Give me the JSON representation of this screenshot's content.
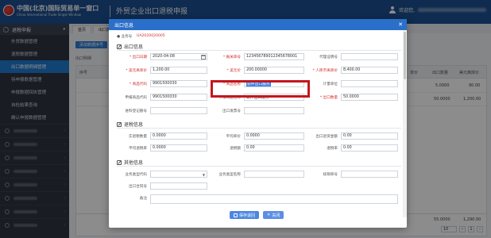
{
  "header": {
    "brand_cn": "中国(北京)国际贸易单一窗口",
    "brand_en": "China International Trade Single Window",
    "system_title": "外贸企业出口退税申报",
    "welcome": "欢迎您,"
  },
  "sidebar": {
    "head": "退税申报",
    "items": [
      {
        "label": "外贸数据管理",
        "active": false
      },
      {
        "label": "退税数据管理",
        "active": false
      },
      {
        "label": "出口数据明细管理",
        "active": true
      },
      {
        "label": "待申报数据管理",
        "active": false
      },
      {
        "label": "申报数据回执管理",
        "active": false
      },
      {
        "label": "自检结果查询",
        "active": false
      },
      {
        "label": "确认申报数据管理",
        "active": false
      }
    ],
    "collapsed_groups": [
      {
        "label": "预申报"
      },
      {
        "label": "代办退税"
      },
      {
        "label": "数据导入"
      },
      {
        "label": "备案"
      },
      {
        "label": "查询"
      },
      {
        "label": "单证"
      },
      {
        "label": "系统维护"
      },
      {
        "label": "其他"
      }
    ]
  },
  "background": {
    "tabs": [
      "首页",
      "出口数据明细管理"
    ],
    "add_button": "添加数据序号",
    "subtab": "出口明细",
    "columns": [
      "序号",
      "",
      "",
      "",
      "",
      "",
      "",
      "",
      "",
      "",
      "",
      "单价",
      "出口数量",
      "美元离岸价"
    ],
    "rows": [
      {
        "unit_price": "",
        "qty": "5.0000",
        "fob": "90.00"
      },
      {
        "unit_price": "",
        "qty": "50.0000",
        "fob": "1,200.00"
      }
    ],
    "totals": {
      "qty": "55.0000",
      "fob": "1,290.00"
    },
    "pager": {
      "page_size": "10",
      "current": "1"
    }
  },
  "modal": {
    "title": "出口信息",
    "serial_label": "业务号",
    "serial_value": "UA2020020005",
    "sections": {
      "export": "出口信息",
      "refund": "退税信息",
      "other": "其他信息"
    },
    "export_fields": {
      "export_date_label": "* 出口日期",
      "export_date": "2020-04-08",
      "customs_no_label": "* 报关单号",
      "customs_no": "123456789012345678001",
      "agent_cert_label": "代理证明号",
      "agent_cert": "",
      "usd_price_label": "* 美元离单价",
      "usd_price": "1,200.00",
      "usd_total_label": "* 美元价",
      "usd_total": "200.00000",
      "rmb_total_label": "* 人民币离单价",
      "rmb_total": "8,400.00",
      "goods_code_label": "* 商品代码",
      "goods_code": "9901500030",
      "goods_name_label": "* 商品名称",
      "goods_name": "软件出口服务",
      "unit_label": "计量单位",
      "unit": "",
      "decl_code_label": "申报商品代码",
      "decl_code": "9901500030",
      "decl_name_label": "申报商品名称",
      "decl_name": "软件出口服务",
      "export_qty_label": "* 出口数量",
      "export_qty": "50.0000",
      "import_reg_label": "进料登记册号",
      "import_reg": "",
      "export_invoice_label": "出口发票号",
      "export_invoice": ""
    },
    "refund_fields": {
      "actual_qty_label": "实退税数量",
      "actual_qty": "0.0000",
      "avg_price_label": "平均单价",
      "avg_price": "0.0000",
      "export_fob_label": "出口退货金额",
      "export_fob": "0.00",
      "avg_cost_label": "平均退税率",
      "avg_cost": "0.0000",
      "refund_amount_label": "退税额",
      "refund_amount": "0.00",
      "refund_rate_label": "退税率",
      "refund_rate": "0.00"
    },
    "other_fields": {
      "biz_type_label": "业务类型代码",
      "biz_type": "",
      "biz_type_name_label": "业务类型名称",
      "biz_type_name": "",
      "contract_no_label": "核销单号",
      "contract_no": "",
      "exp_contract_label": "出口合同号",
      "exp_contract": "",
      "remark_label": "备注",
      "remark": ""
    },
    "buttons": {
      "save": "保存退回",
      "close": "关闭"
    }
  }
}
